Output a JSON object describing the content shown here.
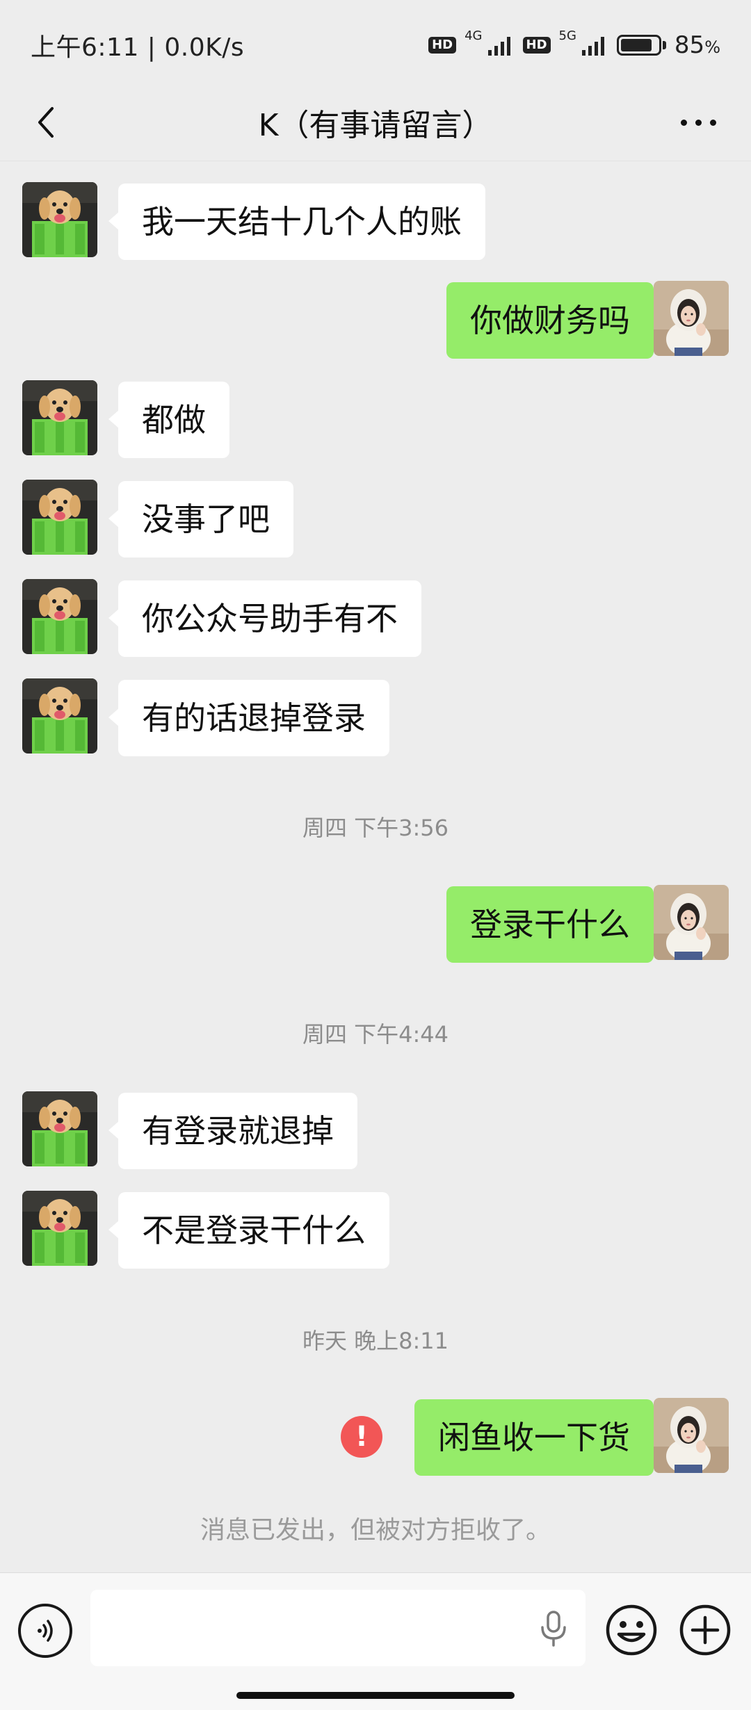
{
  "status_bar": {
    "time_speed": "上午6:11 | 0.0K/s",
    "hd_label": "HD",
    "net1": "4G",
    "net2": "5G",
    "battery_percent": "85",
    "percent_sign": "%",
    "battery_level": 0.85
  },
  "header": {
    "title": "K（有事请留言）"
  },
  "messages": [
    {
      "side": "in",
      "text": "我一天结十几个人的账"
    },
    {
      "side": "out",
      "text": "你做财务吗"
    },
    {
      "side": "in",
      "text": "都做"
    },
    {
      "side": "in",
      "text": "没事了吧"
    },
    {
      "side": "in",
      "text": "你公众号助手有不"
    },
    {
      "side": "in",
      "text": "有的话退掉登录"
    },
    {
      "side": "out",
      "text": "登录干什么"
    },
    {
      "side": "in",
      "text": "有登录就退掉"
    },
    {
      "side": "in",
      "text": "不是登录干什么"
    },
    {
      "side": "out",
      "text": "闲鱼收一下货"
    }
  ],
  "timestamps": [
    "周四 下午3:56",
    "周四 下午4:44",
    "昨天 晚上8:11"
  ],
  "error_mark": "!",
  "system_note": "消息已发出，但被对方拒收了。",
  "icons": {
    "back": "chevron-left-icon",
    "more": "more-dots-icon",
    "voice": "voice-icon",
    "mic": "mic-icon",
    "emoji": "emoji-icon",
    "plus": "plus-icon"
  },
  "colors": {
    "outgoing_bubble": "#95ec69",
    "incoming_bubble": "#ffffff",
    "background": "#ededed",
    "error": "#f25656"
  }
}
